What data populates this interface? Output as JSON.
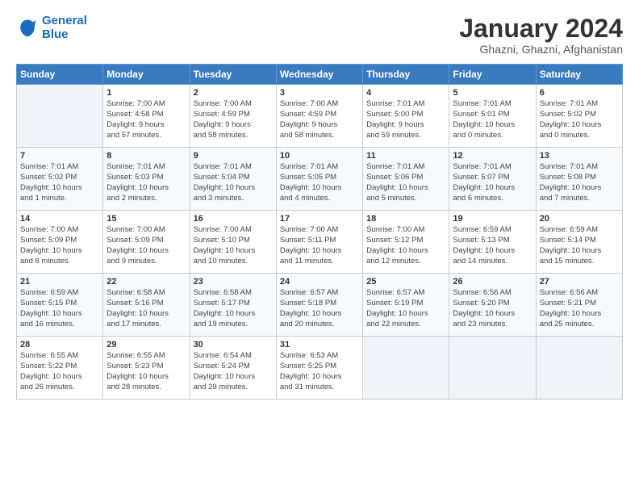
{
  "header": {
    "logo_general": "General",
    "logo_blue": "Blue",
    "month_title": "January 2024",
    "subtitle": "Ghazni, Ghazni, Afghanistan"
  },
  "columns": [
    "Sunday",
    "Monday",
    "Tuesday",
    "Wednesday",
    "Thursday",
    "Friday",
    "Saturday"
  ],
  "weeks": [
    [
      {
        "num": "",
        "lines": []
      },
      {
        "num": "1",
        "lines": [
          "Sunrise: 7:00 AM",
          "Sunset: 4:58 PM",
          "Daylight: 9 hours",
          "and 57 minutes."
        ]
      },
      {
        "num": "2",
        "lines": [
          "Sunrise: 7:00 AM",
          "Sunset: 4:59 PM",
          "Daylight: 9 hours",
          "and 58 minutes."
        ]
      },
      {
        "num": "3",
        "lines": [
          "Sunrise: 7:00 AM",
          "Sunset: 4:59 PM",
          "Daylight: 9 hours",
          "and 58 minutes."
        ]
      },
      {
        "num": "4",
        "lines": [
          "Sunrise: 7:01 AM",
          "Sunset: 5:00 PM",
          "Daylight: 9 hours",
          "and 59 minutes."
        ]
      },
      {
        "num": "5",
        "lines": [
          "Sunrise: 7:01 AM",
          "Sunset: 5:01 PM",
          "Daylight: 10 hours",
          "and 0 minutes."
        ]
      },
      {
        "num": "6",
        "lines": [
          "Sunrise: 7:01 AM",
          "Sunset: 5:02 PM",
          "Daylight: 10 hours",
          "and 0 minutes."
        ]
      }
    ],
    [
      {
        "num": "7",
        "lines": [
          "Sunrise: 7:01 AM",
          "Sunset: 5:02 PM",
          "Daylight: 10 hours",
          "and 1 minute."
        ]
      },
      {
        "num": "8",
        "lines": [
          "Sunrise: 7:01 AM",
          "Sunset: 5:03 PM",
          "Daylight: 10 hours",
          "and 2 minutes."
        ]
      },
      {
        "num": "9",
        "lines": [
          "Sunrise: 7:01 AM",
          "Sunset: 5:04 PM",
          "Daylight: 10 hours",
          "and 3 minutes."
        ]
      },
      {
        "num": "10",
        "lines": [
          "Sunrise: 7:01 AM",
          "Sunset: 5:05 PM",
          "Daylight: 10 hours",
          "and 4 minutes."
        ]
      },
      {
        "num": "11",
        "lines": [
          "Sunrise: 7:01 AM",
          "Sunset: 5:06 PM",
          "Daylight: 10 hours",
          "and 5 minutes."
        ]
      },
      {
        "num": "12",
        "lines": [
          "Sunrise: 7:01 AM",
          "Sunset: 5:07 PM",
          "Daylight: 10 hours",
          "and 6 minutes."
        ]
      },
      {
        "num": "13",
        "lines": [
          "Sunrise: 7:01 AM",
          "Sunset: 5:08 PM",
          "Daylight: 10 hours",
          "and 7 minutes."
        ]
      }
    ],
    [
      {
        "num": "14",
        "lines": [
          "Sunrise: 7:00 AM",
          "Sunset: 5:09 PM",
          "Daylight: 10 hours",
          "and 8 minutes."
        ]
      },
      {
        "num": "15",
        "lines": [
          "Sunrise: 7:00 AM",
          "Sunset: 5:09 PM",
          "Daylight: 10 hours",
          "and 9 minutes."
        ]
      },
      {
        "num": "16",
        "lines": [
          "Sunrise: 7:00 AM",
          "Sunset: 5:10 PM",
          "Daylight: 10 hours",
          "and 10 minutes."
        ]
      },
      {
        "num": "17",
        "lines": [
          "Sunrise: 7:00 AM",
          "Sunset: 5:11 PM",
          "Daylight: 10 hours",
          "and 11 minutes."
        ]
      },
      {
        "num": "18",
        "lines": [
          "Sunrise: 7:00 AM",
          "Sunset: 5:12 PM",
          "Daylight: 10 hours",
          "and 12 minutes."
        ]
      },
      {
        "num": "19",
        "lines": [
          "Sunrise: 6:59 AM",
          "Sunset: 5:13 PM",
          "Daylight: 10 hours",
          "and 14 minutes."
        ]
      },
      {
        "num": "20",
        "lines": [
          "Sunrise: 6:59 AM",
          "Sunset: 5:14 PM",
          "Daylight: 10 hours",
          "and 15 minutes."
        ]
      }
    ],
    [
      {
        "num": "21",
        "lines": [
          "Sunrise: 6:59 AM",
          "Sunset: 5:15 PM",
          "Daylight: 10 hours",
          "and 16 minutes."
        ]
      },
      {
        "num": "22",
        "lines": [
          "Sunrise: 6:58 AM",
          "Sunset: 5:16 PM",
          "Daylight: 10 hours",
          "and 17 minutes."
        ]
      },
      {
        "num": "23",
        "lines": [
          "Sunrise: 6:58 AM",
          "Sunset: 5:17 PM",
          "Daylight: 10 hours",
          "and 19 minutes."
        ]
      },
      {
        "num": "24",
        "lines": [
          "Sunrise: 6:57 AM",
          "Sunset: 5:18 PM",
          "Daylight: 10 hours",
          "and 20 minutes."
        ]
      },
      {
        "num": "25",
        "lines": [
          "Sunrise: 6:57 AM",
          "Sunset: 5:19 PM",
          "Daylight: 10 hours",
          "and 22 minutes."
        ]
      },
      {
        "num": "26",
        "lines": [
          "Sunrise: 6:56 AM",
          "Sunset: 5:20 PM",
          "Daylight: 10 hours",
          "and 23 minutes."
        ]
      },
      {
        "num": "27",
        "lines": [
          "Sunrise: 6:56 AM",
          "Sunset: 5:21 PM",
          "Daylight: 10 hours",
          "and 25 minutes."
        ]
      }
    ],
    [
      {
        "num": "28",
        "lines": [
          "Sunrise: 6:55 AM",
          "Sunset: 5:22 PM",
          "Daylight: 10 hours",
          "and 26 minutes."
        ]
      },
      {
        "num": "29",
        "lines": [
          "Sunrise: 6:55 AM",
          "Sunset: 5:23 PM",
          "Daylight: 10 hours",
          "and 28 minutes."
        ]
      },
      {
        "num": "30",
        "lines": [
          "Sunrise: 6:54 AM",
          "Sunset: 5:24 PM",
          "Daylight: 10 hours",
          "and 29 minutes."
        ]
      },
      {
        "num": "31",
        "lines": [
          "Sunrise: 6:53 AM",
          "Sunset: 5:25 PM",
          "Daylight: 10 hours",
          "and 31 minutes."
        ]
      },
      {
        "num": "",
        "lines": []
      },
      {
        "num": "",
        "lines": []
      },
      {
        "num": "",
        "lines": []
      }
    ]
  ]
}
